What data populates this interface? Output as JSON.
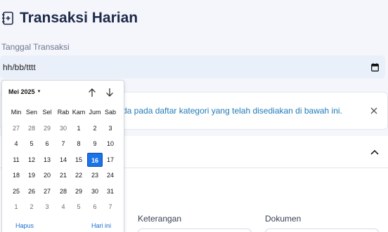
{
  "page": {
    "title": "Transaksi Harian",
    "icon": "journal-plus-icon"
  },
  "date_field": {
    "label": "Tanggal Transaksi",
    "value": "hh/bb/tttt",
    "icon": "calendar-icon"
  },
  "info_banner": {
    "text": "da pada daftar kategori yang telah disediakan di bawah ini.",
    "close_icon": "close-icon"
  },
  "collapse": {
    "icon": "chevron-up-icon"
  },
  "form_columns": [
    {
      "label": "Keterangan"
    },
    {
      "label": "Dokumen"
    }
  ],
  "calendar": {
    "month_label": "Mei 2025",
    "weekdays": [
      "Min",
      "Sen",
      "Sel",
      "Rab",
      "Kam",
      "Jum",
      "Sab"
    ],
    "weeks": [
      [
        "27",
        "28",
        "29",
        "30",
        "1",
        "2",
        "3"
      ],
      [
        "4",
        "5",
        "6",
        "7",
        "8",
        "9",
        "10"
      ],
      [
        "11",
        "12",
        "13",
        "14",
        "15",
        "16",
        "17"
      ],
      [
        "18",
        "19",
        "20",
        "21",
        "22",
        "23",
        "24"
      ],
      [
        "25",
        "26",
        "27",
        "28",
        "29",
        "30",
        "31"
      ],
      [
        "1",
        "2",
        "3",
        "4",
        "5",
        "6",
        "7"
      ]
    ],
    "selected_day": "16",
    "clear_label": "Hapus",
    "today_label": "Hari ini"
  },
  "colors": {
    "accent": "#1a73e8",
    "link": "#1f7ab8",
    "title": "#1e2a4a"
  }
}
